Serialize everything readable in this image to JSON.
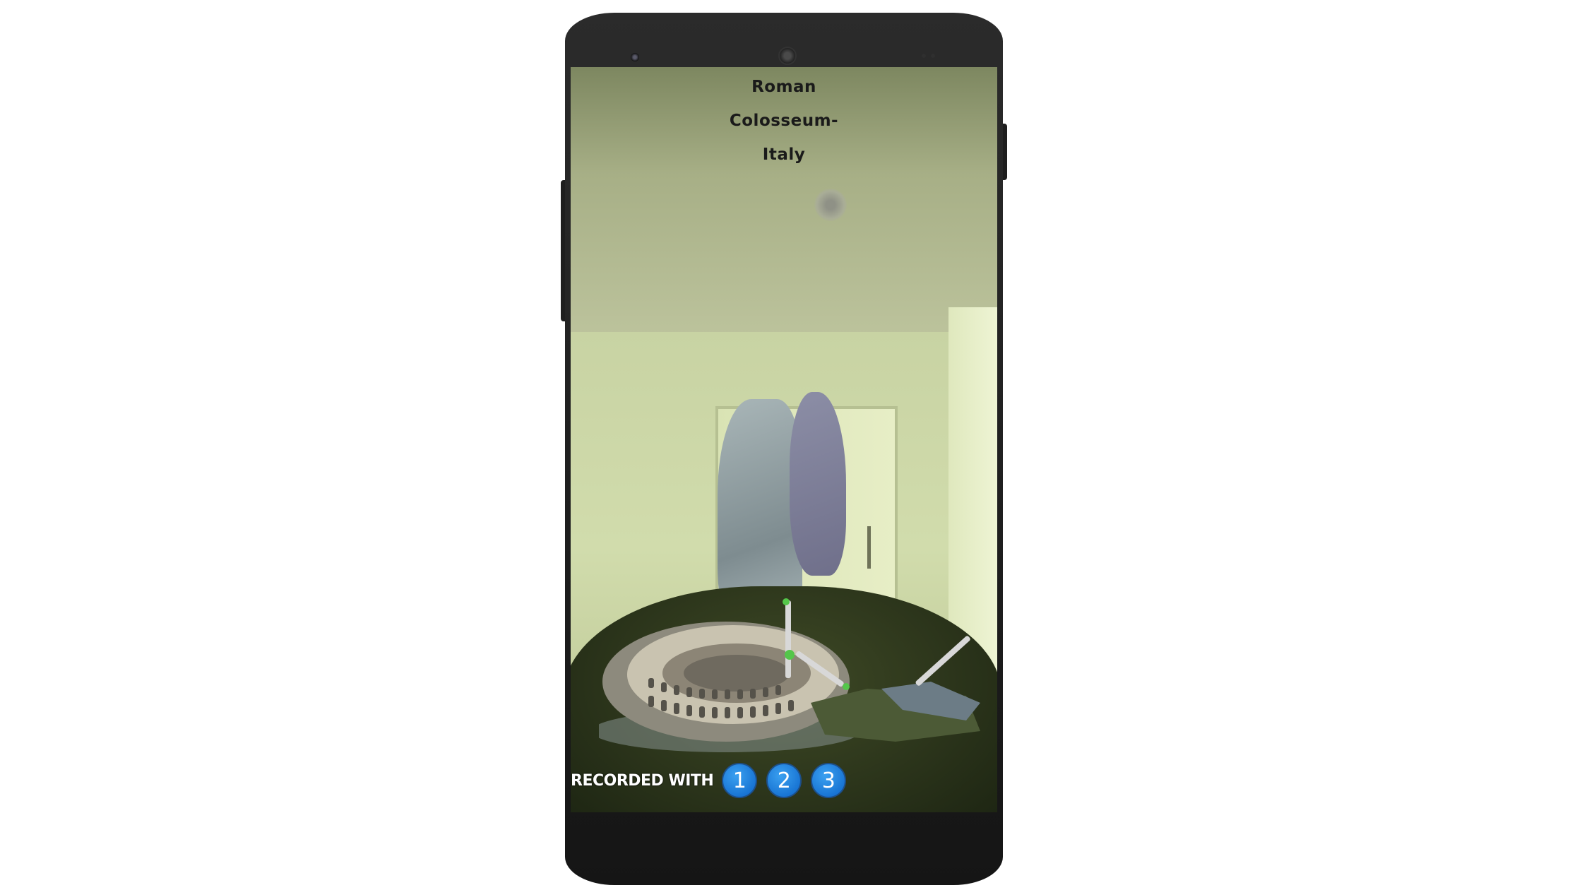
{
  "ar_view": {
    "title_lines": [
      "Roman",
      "Colosseum-",
      "Italy"
    ]
  },
  "recorded": {
    "label": "RECORDED WITH",
    "badges": [
      "1",
      "2",
      "3"
    ]
  },
  "colors": {
    "badge_blue": "#0b63c8",
    "phone_body": "#1e1e1e",
    "gizmo_green": "#54c64a"
  }
}
